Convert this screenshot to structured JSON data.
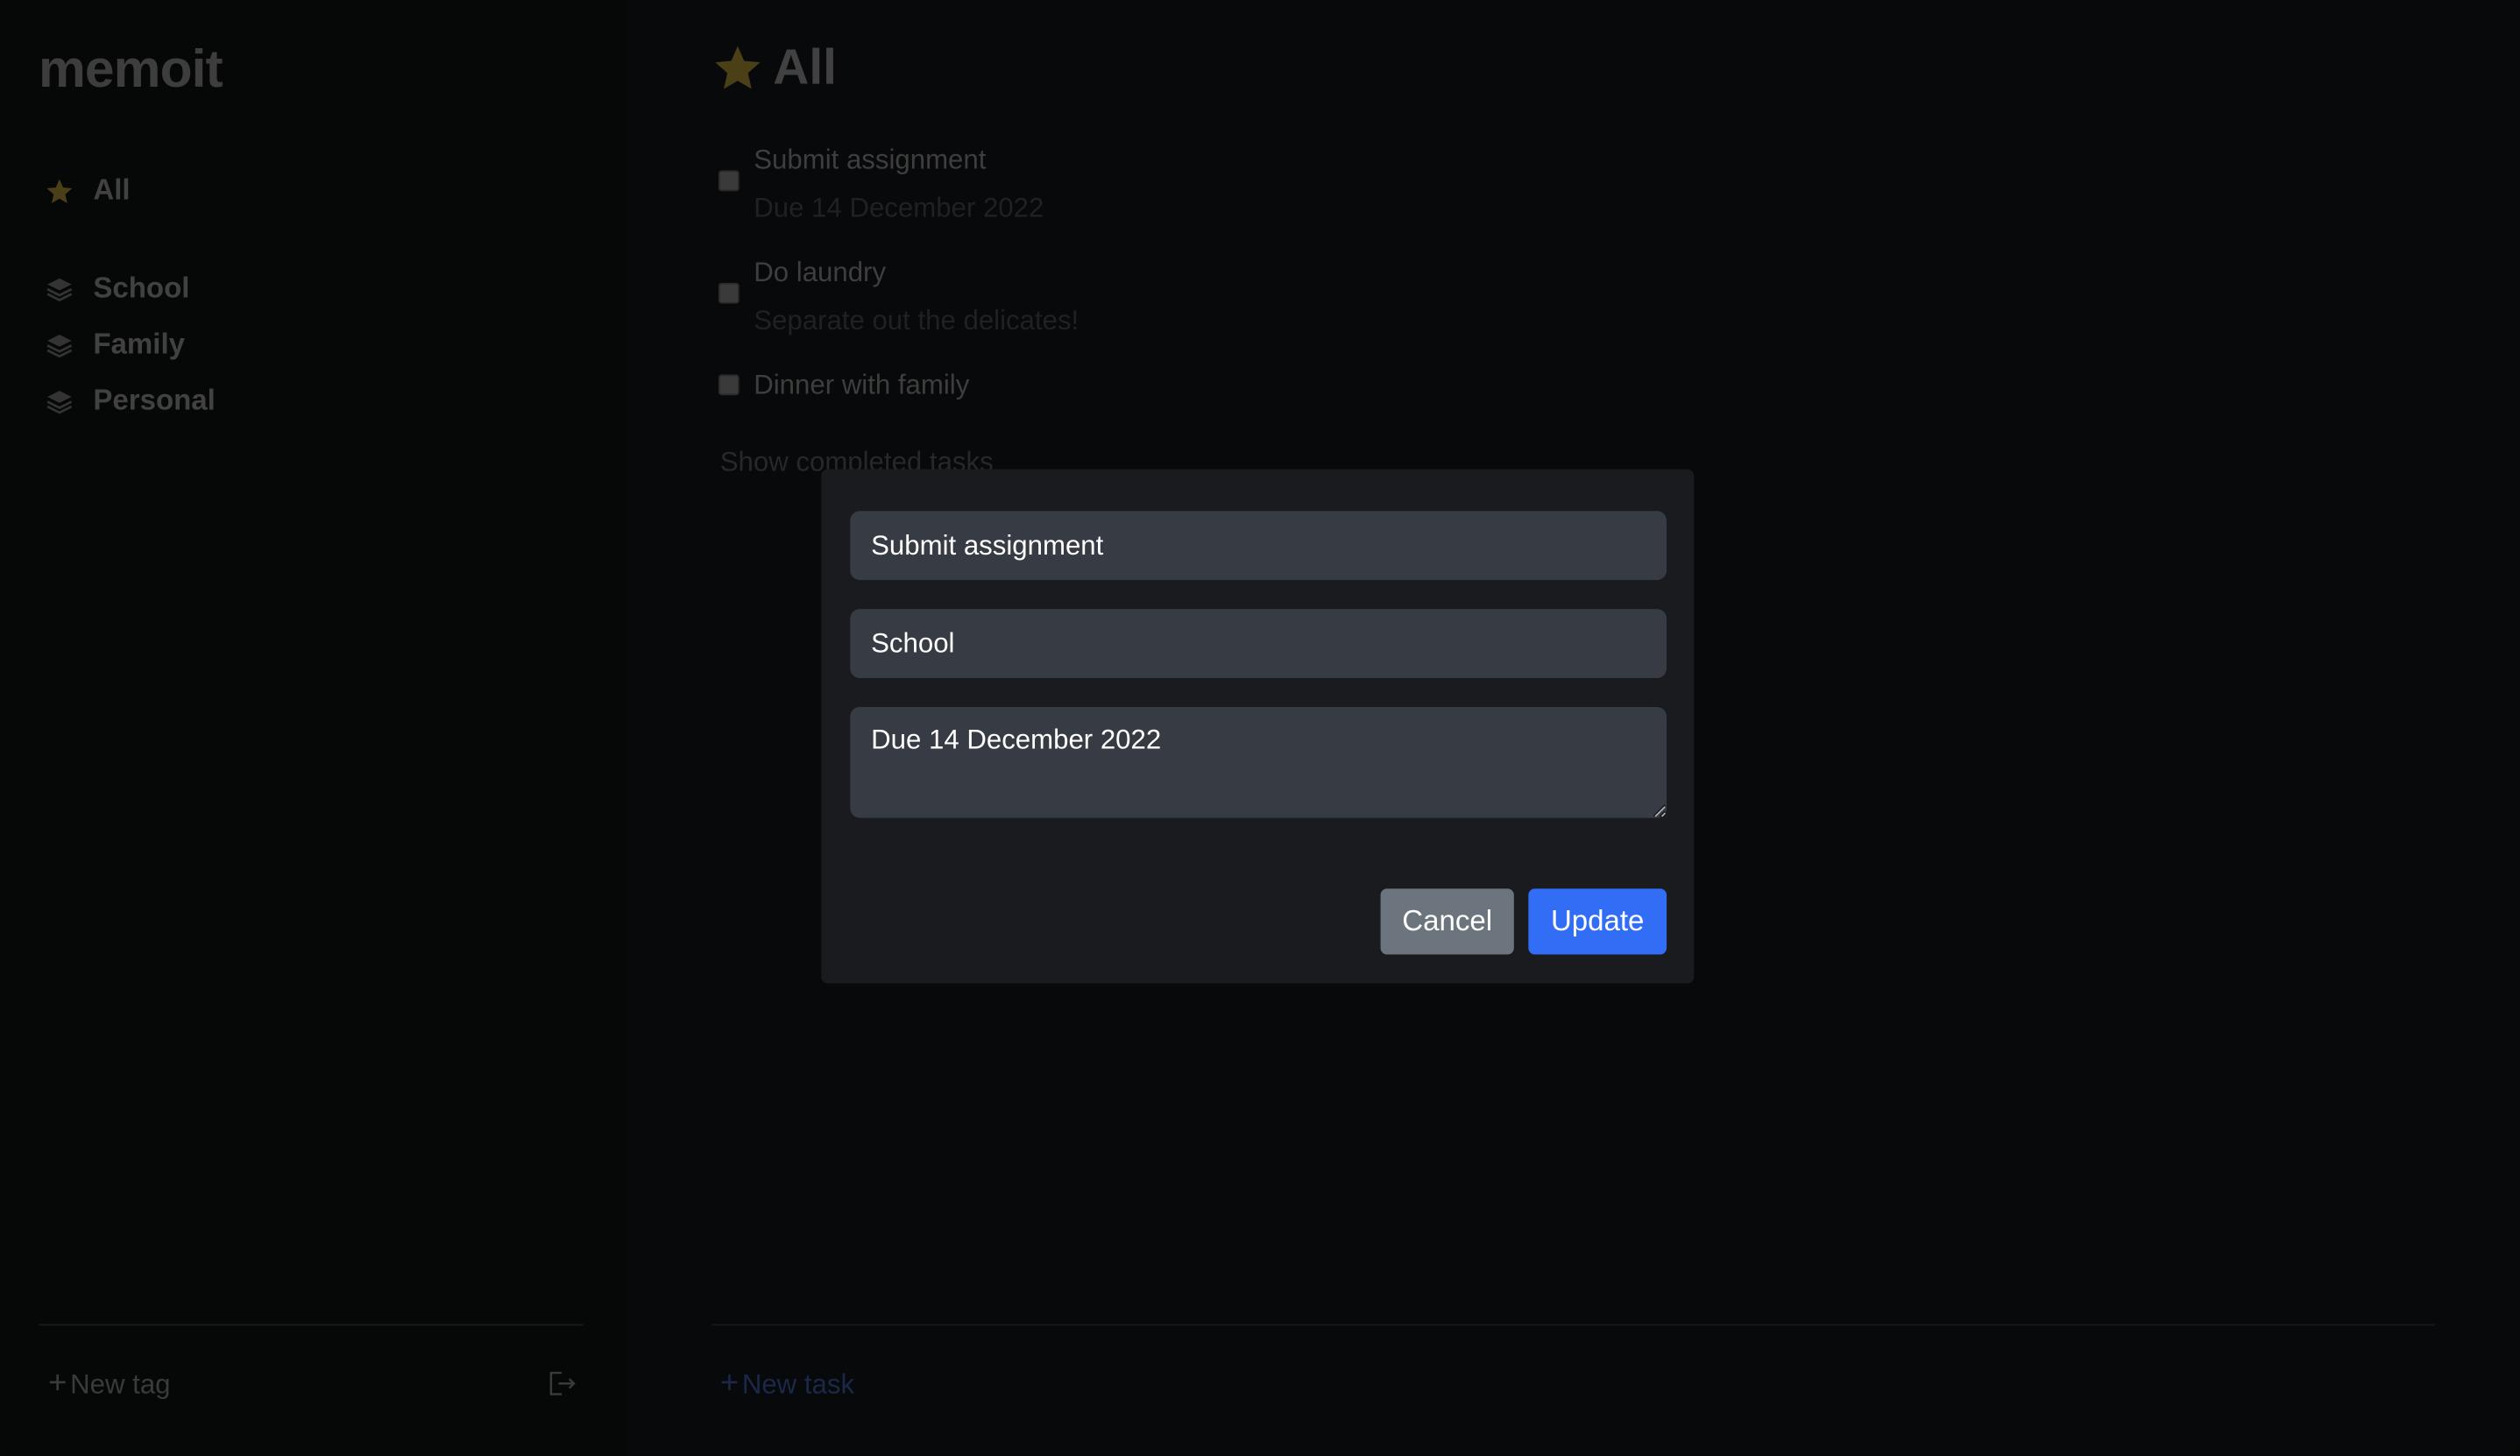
{
  "app": {
    "name": "memoit"
  },
  "sidebar": {
    "all_label": "All",
    "tags": [
      {
        "label": "School"
      },
      {
        "label": "Family"
      },
      {
        "label": "Personal"
      }
    ],
    "new_tag_label": "New tag"
  },
  "main": {
    "title": "All",
    "tasks": [
      {
        "title": "Submit assignment",
        "note": "Due 14 December 2022",
        "done": false
      },
      {
        "title": "Do laundry",
        "note": "Separate out the delicates!",
        "done": false
      },
      {
        "title": "Dinner with family",
        "note": "",
        "done": false
      }
    ],
    "show_completed_label": "Show completed tasks",
    "new_task_label": "New task"
  },
  "modal": {
    "title_value": "Submit assignment",
    "tag_value": "School",
    "note_value": "Due 14 December 2022",
    "cancel_label": "Cancel",
    "update_label": "Update"
  },
  "colors": {
    "accent": "#316ef5",
    "secondary": "#6c757d",
    "star": "#4a3f16",
    "modal_bg": "#1a1b1e",
    "input_bg": "#373b43"
  },
  "icons": {
    "all": "star-icon",
    "tag": "layers-icon",
    "logout": "logout-icon",
    "add": "plus-icon"
  }
}
